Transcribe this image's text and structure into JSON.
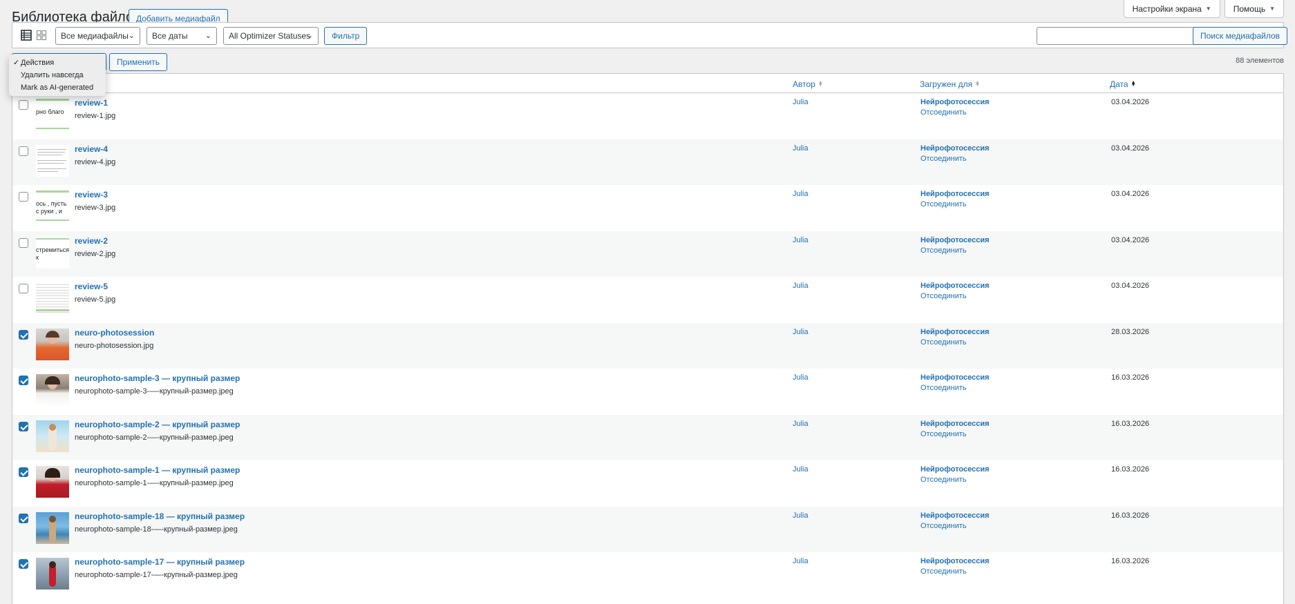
{
  "header": {
    "title": "Библиотека файлов",
    "add_new": "Добавить медиафайл",
    "screen_options": "Настройки экрана",
    "help": "Помощь"
  },
  "filters": {
    "media_type": "Все медиафайлы",
    "dates": "Все даты",
    "optimizer": "All Optimizer Statuses",
    "filter_button": "Фильтр",
    "search_button": "Поиск медиафайлов",
    "search_value": ""
  },
  "bulk": {
    "apply": "Применить",
    "options": [
      "Действия",
      "Удалить навсегда",
      "Mark as AI-generated"
    ],
    "selected": "Действия",
    "count": "88 элементов"
  },
  "columns": {
    "author": "Автор",
    "uploaded_to": "Загружен для",
    "date": "Дата"
  },
  "rows": [
    {
      "title": "review-1",
      "file": "review-1.jpg",
      "author": "Julia",
      "parent": "Нейрофотосессия",
      "detach": "Отсоединить",
      "date": "03.04.2026",
      "checked": false,
      "thumb": "doc-a",
      "thumb_text": "рно благо"
    },
    {
      "title": "review-4",
      "file": "review-4.jpg",
      "author": "Julia",
      "parent": "Нейрофотосессия",
      "detach": "Отсоединить",
      "date": "03.04.2026",
      "checked": false,
      "thumb": "doc-b",
      "thumb_text": ""
    },
    {
      "title": "review-3",
      "file": "review-3.jpg",
      "author": "Julia",
      "parent": "Нейрофотосессия",
      "detach": "Отсоединить",
      "date": "03.04.2026",
      "checked": false,
      "thumb": "doc-c",
      "thumb_text": "ось , пусть с руки , и пуст"
    },
    {
      "title": "review-2",
      "file": "review-2.jpg",
      "author": "Julia",
      "parent": "Нейрофотосессия",
      "detach": "Отсоединить",
      "date": "03.04.2026",
      "checked": false,
      "thumb": "doc-d",
      "thumb_text": "стремиться к"
    },
    {
      "title": "review-5",
      "file": "review-5.jpg",
      "author": "Julia",
      "parent": "Нейрофотосессия",
      "detach": "Отсоединить",
      "date": "03.04.2026",
      "checked": false,
      "thumb": "doc-e",
      "thumb_text": ""
    },
    {
      "title": "neuro-photosession",
      "file": "neuro-photosession.jpg",
      "author": "Julia",
      "parent": "Нейрофотосессия",
      "detach": "Отсоединить",
      "date": "28.03.2026",
      "checked": true,
      "thumb": "photo-orange",
      "thumb_text": ""
    },
    {
      "title": "neurophoto-sample-3 — крупный размер",
      "file": "neurophoto-sample-3-—-крупный-размер.jpeg",
      "author": "Julia",
      "parent": "Нейрофотосессия",
      "detach": "Отсоединить",
      "date": "16.03.2026",
      "checked": true,
      "thumb": "photo-white",
      "thumb_text": ""
    },
    {
      "title": "neurophoto-sample-2 — крупный размер",
      "file": "neurophoto-sample-2-—-крупный-размер.jpeg",
      "author": "Julia",
      "parent": "Нейрофотосессия",
      "detach": "Отсоединить",
      "date": "16.03.2026",
      "checked": true,
      "thumb": "photo-beach",
      "thumb_text": ""
    },
    {
      "title": "neurophoto-sample-1 — крупный размер",
      "file": "neurophoto-sample-1-—-крупный-размер.jpeg",
      "author": "Julia",
      "parent": "Нейрофотосессия",
      "detach": "Отсоединить",
      "date": "16.03.2026",
      "checked": true,
      "thumb": "photo-red",
      "thumb_text": ""
    },
    {
      "title": "neurophoto-sample-18 — крупный размер",
      "file": "neurophoto-sample-18-—-крупный-размер.jpeg",
      "author": "Julia",
      "parent": "Нейрофотосессия",
      "detach": "Отсоединить",
      "date": "16.03.2026",
      "checked": true,
      "thumb": "photo-sea",
      "thumb_text": ""
    },
    {
      "title": "neurophoto-sample-17 — крупный размер",
      "file": "neurophoto-sample-17-—-крупный-размер.jpeg",
      "author": "Julia",
      "parent": "Нейрофотосессия",
      "detach": "Отсоединить",
      "date": "16.03.2026",
      "checked": true,
      "thumb": "photo-city",
      "thumb_text": ""
    }
  ]
}
